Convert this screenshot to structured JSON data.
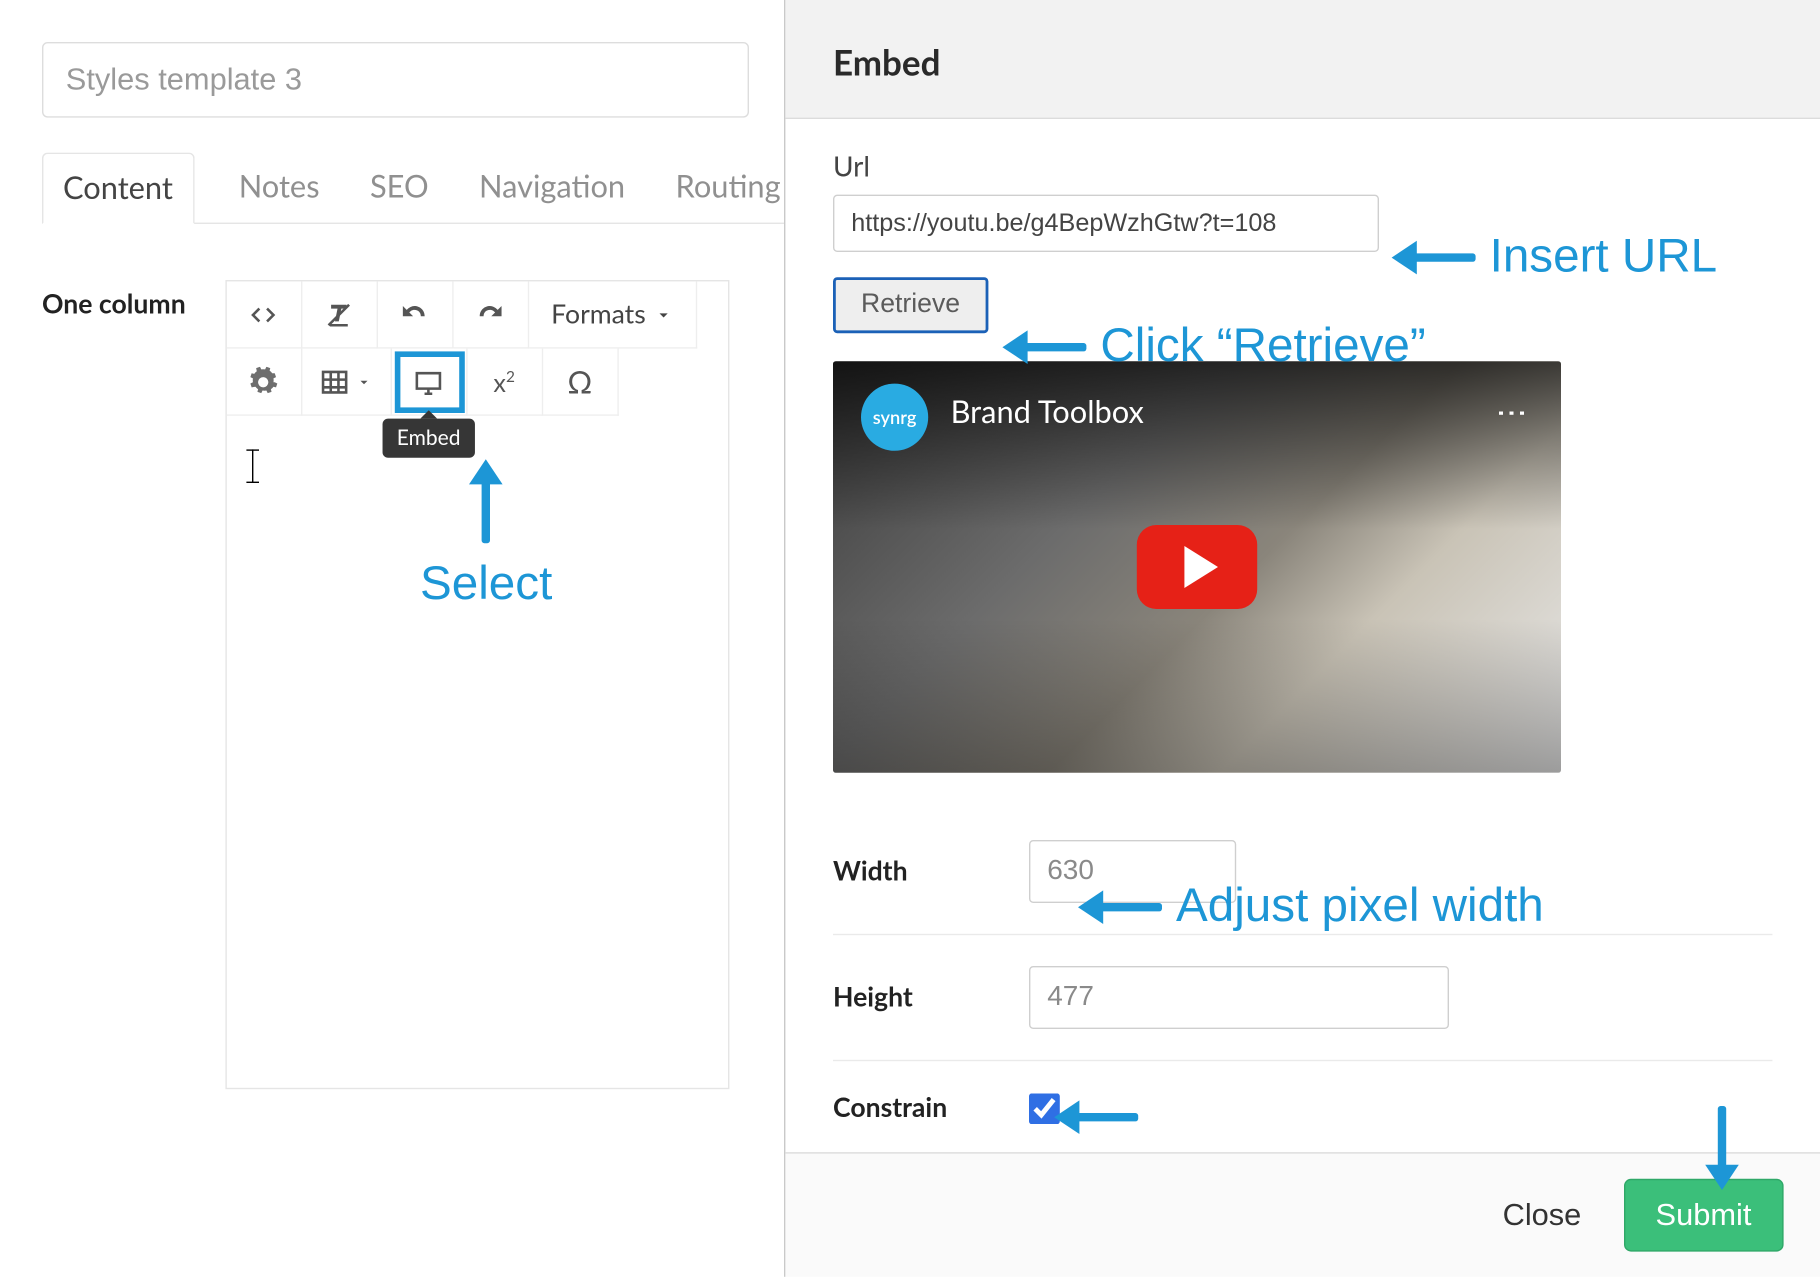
{
  "editor": {
    "title_placeholder": "Styles template 3",
    "tabs": [
      "Content",
      "Notes",
      "SEO",
      "Navigation",
      "Routing"
    ],
    "active_tab_index": 0,
    "section_label": "One column",
    "formats_label": "Formats",
    "embed_tooltip": "Embed"
  },
  "modal": {
    "title": "Embed",
    "url_label": "Url",
    "url_value": "https://youtu.be/g4BepWzhGtw?t=108",
    "retrieve_label": "Retrieve",
    "video": {
      "channel_name": "synrg",
      "video_title": "Brand Toolbox"
    },
    "width_label": "Width",
    "width_value": "630",
    "height_label": "Height",
    "height_value": "477",
    "constrain_label": "Constrain",
    "constrain_checked": true,
    "close_label": "Close",
    "submit_label": "Submit"
  },
  "annotations": {
    "insert_url": "Insert URL",
    "click_retrieve": "Click “Retrieve”",
    "select": "Select",
    "adjust_width": "Adjust pixel width"
  }
}
